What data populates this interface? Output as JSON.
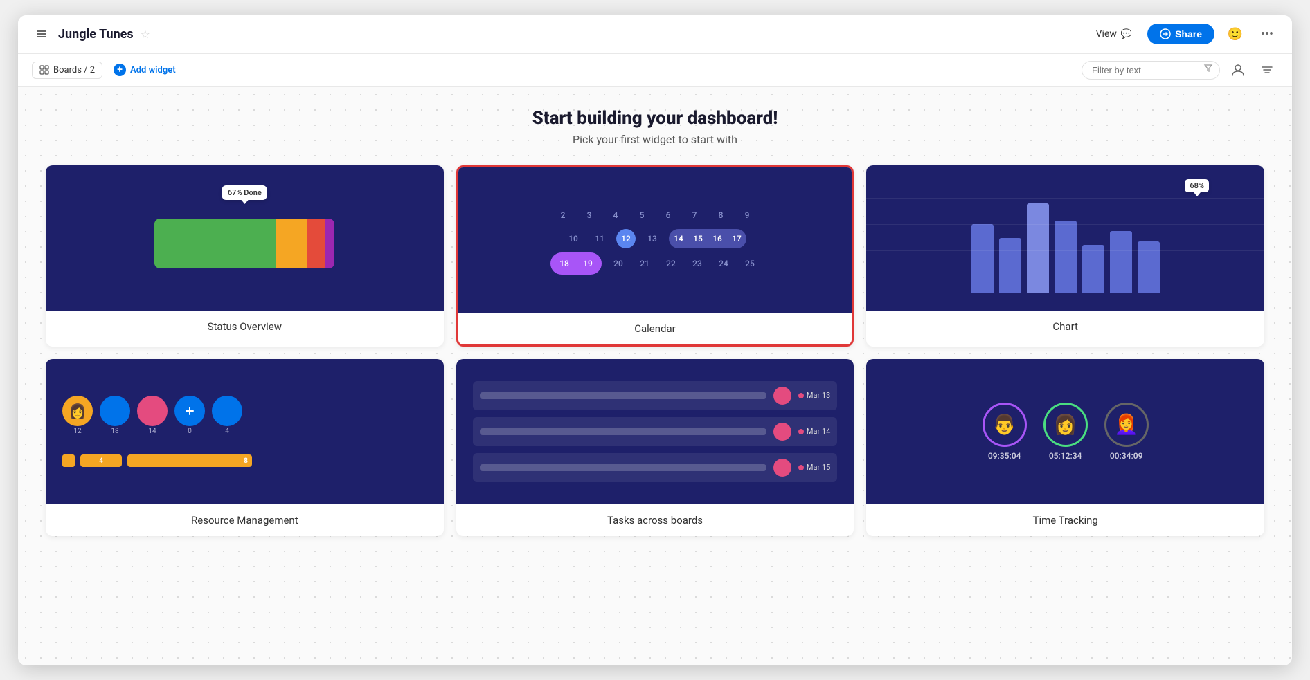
{
  "app": {
    "title": "Jungle Tunes",
    "star": "☆"
  },
  "topbar": {
    "view_label": "View",
    "share_label": "Share",
    "sidebar_toggle": "›"
  },
  "subbar": {
    "boards_label": "Boards / 2",
    "add_widget_label": "Add widget",
    "filter_placeholder": "Filter by text"
  },
  "header": {
    "title": "Start building your dashboard!",
    "subtitle": "Pick your first widget to start with"
  },
  "widgets": [
    {
      "id": "status-overview",
      "label": "Status Overview",
      "selected": false,
      "tooltip": "67% Done"
    },
    {
      "id": "calendar",
      "label": "Calendar",
      "selected": true
    },
    {
      "id": "chart",
      "label": "Chart",
      "selected": false,
      "tooltip": "68%"
    },
    {
      "id": "resource-management",
      "label": "Resource Management",
      "selected": false
    },
    {
      "id": "tasks-across-boards",
      "label": "Tasks across boards",
      "selected": false
    },
    {
      "id": "time-tracking",
      "label": "Time Tracking",
      "selected": false
    }
  ],
  "calendar": {
    "rows": [
      [
        "2",
        "3",
        "4",
        "5",
        "6",
        "7",
        "8",
        "9"
      ],
      [
        "10",
        "11",
        "12",
        "13",
        "14",
        "15",
        "16",
        "17"
      ],
      [
        "18",
        "19",
        "20",
        "21",
        "22",
        "23",
        "24",
        "25"
      ]
    ]
  },
  "chart": {
    "bars": [
      120,
      95,
      140,
      110,
      75,
      100,
      85
    ],
    "tooltip": "68%"
  },
  "time_tracking": {
    "users": [
      {
        "time": "09:35:04"
      },
      {
        "time": "05:12:34"
      },
      {
        "time": "00:34:09"
      }
    ]
  },
  "tasks": [
    {
      "date": "Mar 13"
    },
    {
      "date": "Mar 14"
    },
    {
      "date": "Mar 15"
    }
  ],
  "resource": {
    "avatars": [
      {
        "count": "12"
      },
      {
        "count": "18"
      },
      {
        "count": "14"
      },
      {
        "count": "0"
      },
      {
        "count": "4"
      }
    ],
    "bars": [
      {
        "count": "4",
        "width": 60
      },
      {
        "count": "8",
        "width": 160
      }
    ]
  }
}
